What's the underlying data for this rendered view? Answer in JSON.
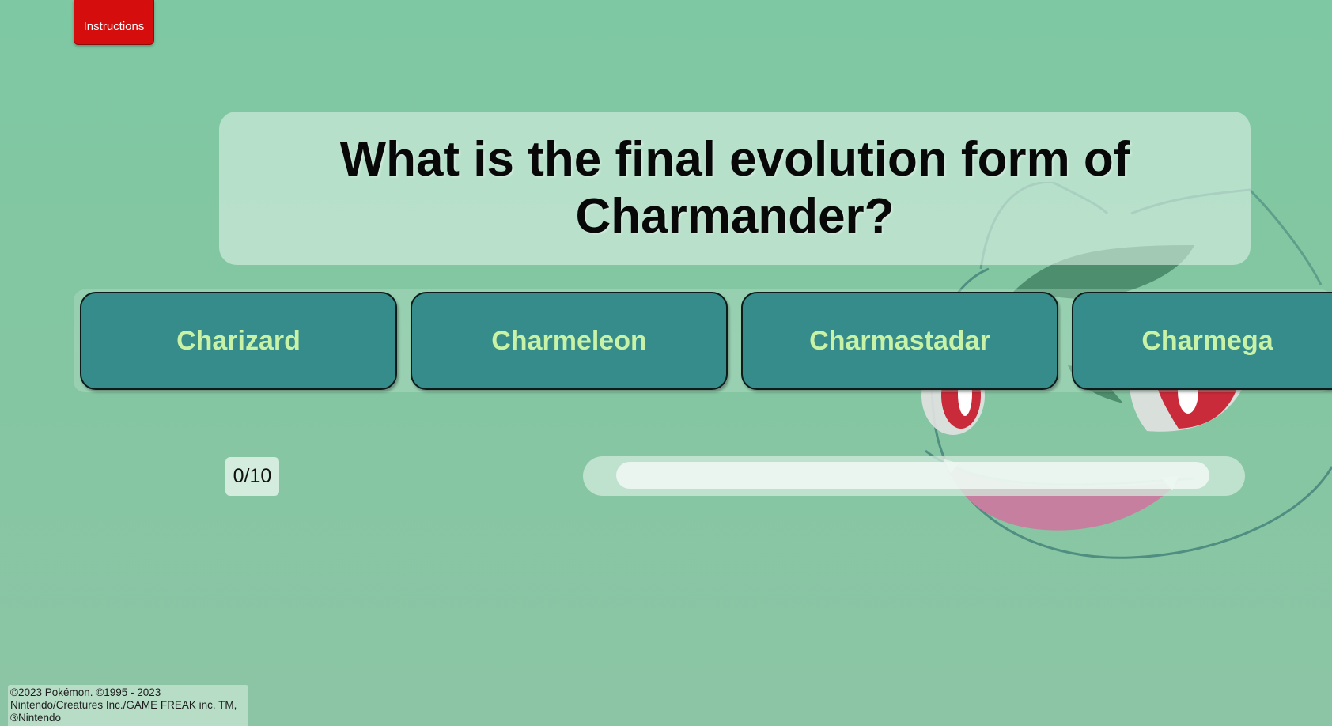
{
  "header": {
    "instructions_label": "Instructions"
  },
  "question": {
    "text": "What is the final evolution form of Charmander?"
  },
  "answers": [
    {
      "label": "Charizard"
    },
    {
      "label": "Charmeleon"
    },
    {
      "label": "Charmastadar"
    },
    {
      "label": "Charmega"
    }
  ],
  "score": {
    "text": "0/10"
  },
  "progress": {
    "fraction": 0
  },
  "footer": {
    "copyright_lines": [
      "©2023 Pokémon. ©1995 - 2023",
      "Nintendo/Creatures Inc./GAME FREAK inc. TM,",
      "®Nintendo"
    ]
  },
  "colors": {
    "background": "#7ec8a3",
    "instructions_button": "#d50d0d",
    "answer_button": "#368b8b",
    "answer_text": "#c8f2a6"
  },
  "background_image": "bulbasaur-face-icon"
}
